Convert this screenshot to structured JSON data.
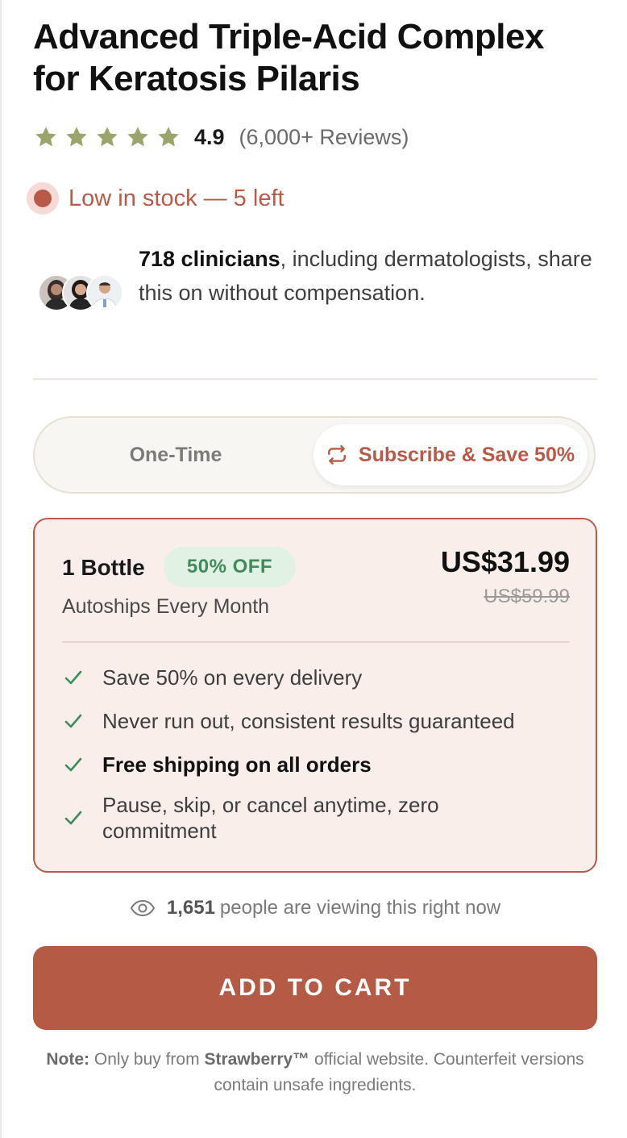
{
  "product": {
    "title": "Advanced Triple-Acid Complex for Keratosis Pilaris",
    "rating": {
      "stars": 5,
      "score": "4.9",
      "reviews": "(6,000+ Reviews)",
      "star_color": "#9aa46b"
    },
    "stock": {
      "text": "Low in stock — 5 left",
      "color": "#b85a47"
    },
    "clinicians": {
      "count": "718 clinicians",
      "text_rest": ", including dermatologists, share this on without compensation."
    }
  },
  "purchase_toggle": {
    "options": [
      {
        "label": "One-Time",
        "selected": false
      },
      {
        "label": "Subscribe & Save 50%",
        "selected": true,
        "icon": "repeat-icon"
      }
    ]
  },
  "plan": {
    "name": "1 Bottle",
    "badge": "50% OFF",
    "subtitle": "Autoships Every Month",
    "price": "US$31.99",
    "old_price": "US$59.99",
    "benefits": [
      {
        "text": "Save 50% on every delivery",
        "bold": false
      },
      {
        "text": "Never run out, consistent results guaranteed",
        "bold": false
      },
      {
        "text": "Free shipping on all orders",
        "bold": true
      },
      {
        "text": "Pause, skip, or cancel anytime, zero commitment",
        "bold": false
      }
    ],
    "check_color": "#3f8c5a",
    "accent": "#b85a47"
  },
  "viewers": {
    "count": "1,651",
    "text": "people are viewing this right now",
    "icon": "eye-icon"
  },
  "cta": {
    "label": "ADD TO CART",
    "color": "#b55a45"
  },
  "note": {
    "prefix": "Note:",
    "text_before": "Only buy from",
    "brand": "Strawberry™",
    "text_after": "official website. Counterfeit versions contain unsafe ingredients."
  }
}
